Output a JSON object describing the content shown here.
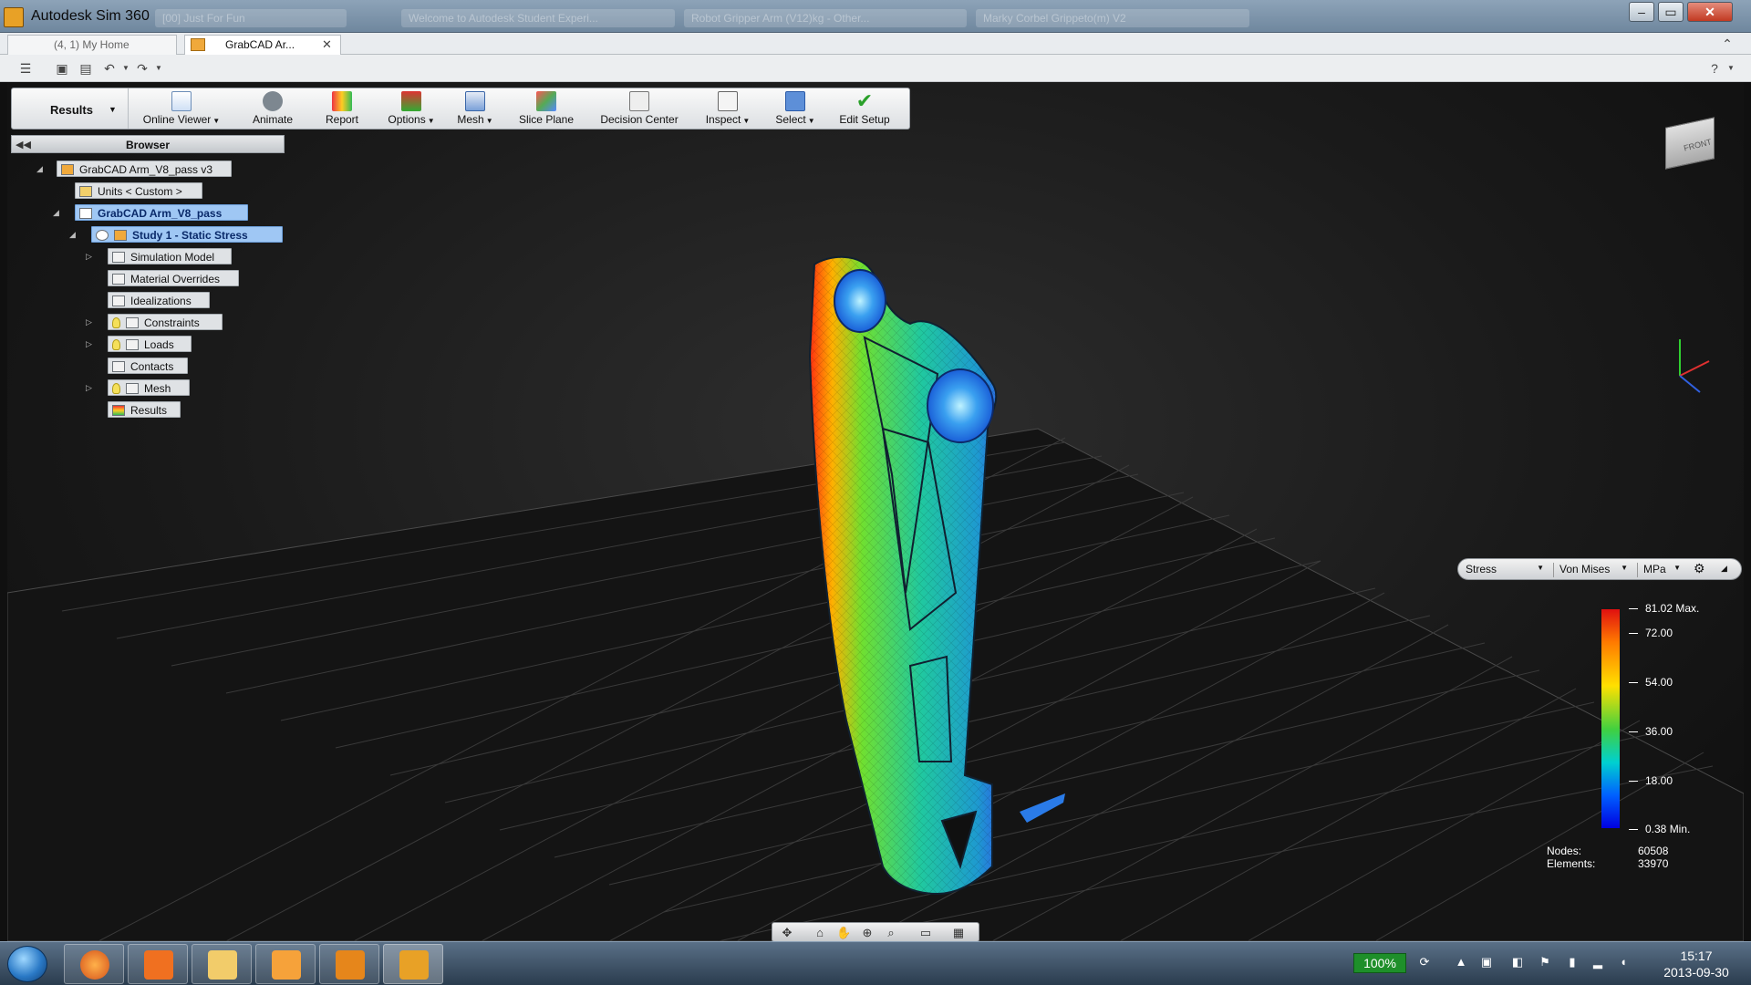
{
  "window": {
    "title": "Autodesk Sim 360"
  },
  "background_tabs": [
    "[00] Just For Fun",
    "Welcome to Autodesk Student Experi...",
    "Robot Gripper Arm (V12)kg - Other...",
    "Marky Corbel Grippeto(m) V2"
  ],
  "doc_tabs": {
    "home": "(4, 1) My Home",
    "active": "GrabCAD Ar..."
  },
  "ribbon": {
    "mode": "Results",
    "buttons": [
      {
        "label": "Online Viewer",
        "dropdown": true
      },
      {
        "label": "Animate"
      },
      {
        "label": "Report"
      },
      {
        "label": "Options",
        "dropdown": true
      },
      {
        "label": "Mesh",
        "dropdown": true
      },
      {
        "label": "Slice Plane"
      },
      {
        "label": "Decision Center"
      },
      {
        "label": "Inspect",
        "dropdown": true
      },
      {
        "label": "Select",
        "dropdown": true,
        "active": true
      },
      {
        "label": "Edit Setup"
      }
    ]
  },
  "browser": {
    "title": "Browser",
    "tree": [
      "GrabCAD Arm_V8_pass v3",
      "Units < Custom >",
      "GrabCAD Arm_V8_pass",
      "Study 1 - Static Stress",
      "Simulation Model",
      "Material Overrides",
      "Idealizations",
      "Constraints",
      "Loads",
      "Contacts",
      "Mesh",
      "Results"
    ]
  },
  "viewcube": {
    "label": "FRONT"
  },
  "legend": {
    "result_type": "Stress",
    "component": "Von Mises",
    "unit": "MPa",
    "max_label": "81.02 Max.",
    "min_label": "0.38 Min.",
    "ticks": [
      "72.00",
      "54.00",
      "36.00",
      "18.00"
    ],
    "stats": {
      "nodes_label": "Nodes:",
      "nodes": "60508",
      "elements_label": "Elements:",
      "elements": "33970"
    }
  },
  "taskbar": {
    "battery": "100%",
    "time": "15:17",
    "date": "2013-09-30"
  },
  "colors": {
    "scale_top": "#e01010",
    "scale_bottom": "#0000e0",
    "selection": "#9fc7f4",
    "accent": "#e8a126"
  }
}
